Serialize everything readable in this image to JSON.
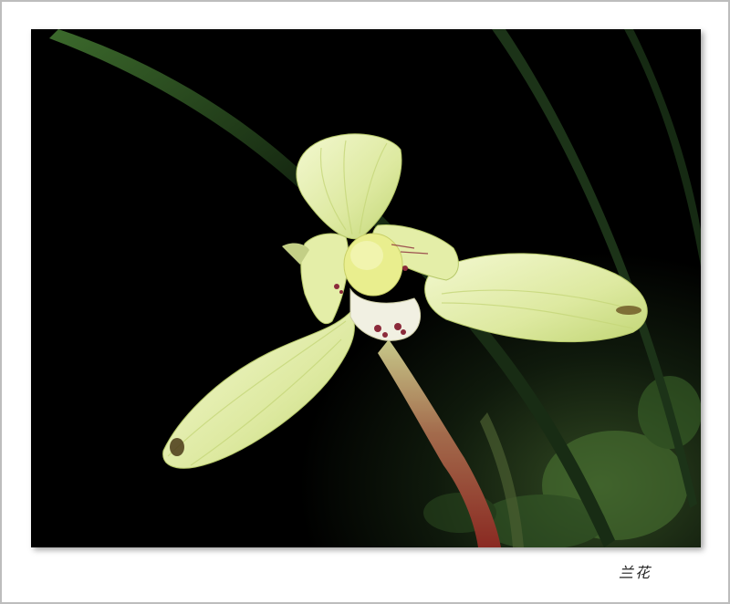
{
  "caption": "兰花",
  "subject": "orchid-flower-photo",
  "colors": {
    "background": "#000000",
    "petal": "#e9f3b4",
    "petal_vein": "#c9dd6a",
    "column": "#eef19a",
    "spots": "#8b2a3a",
    "stem": "#b24a3a",
    "leaf": "#1f3a1a",
    "frame_border": "#bdbdbd"
  }
}
